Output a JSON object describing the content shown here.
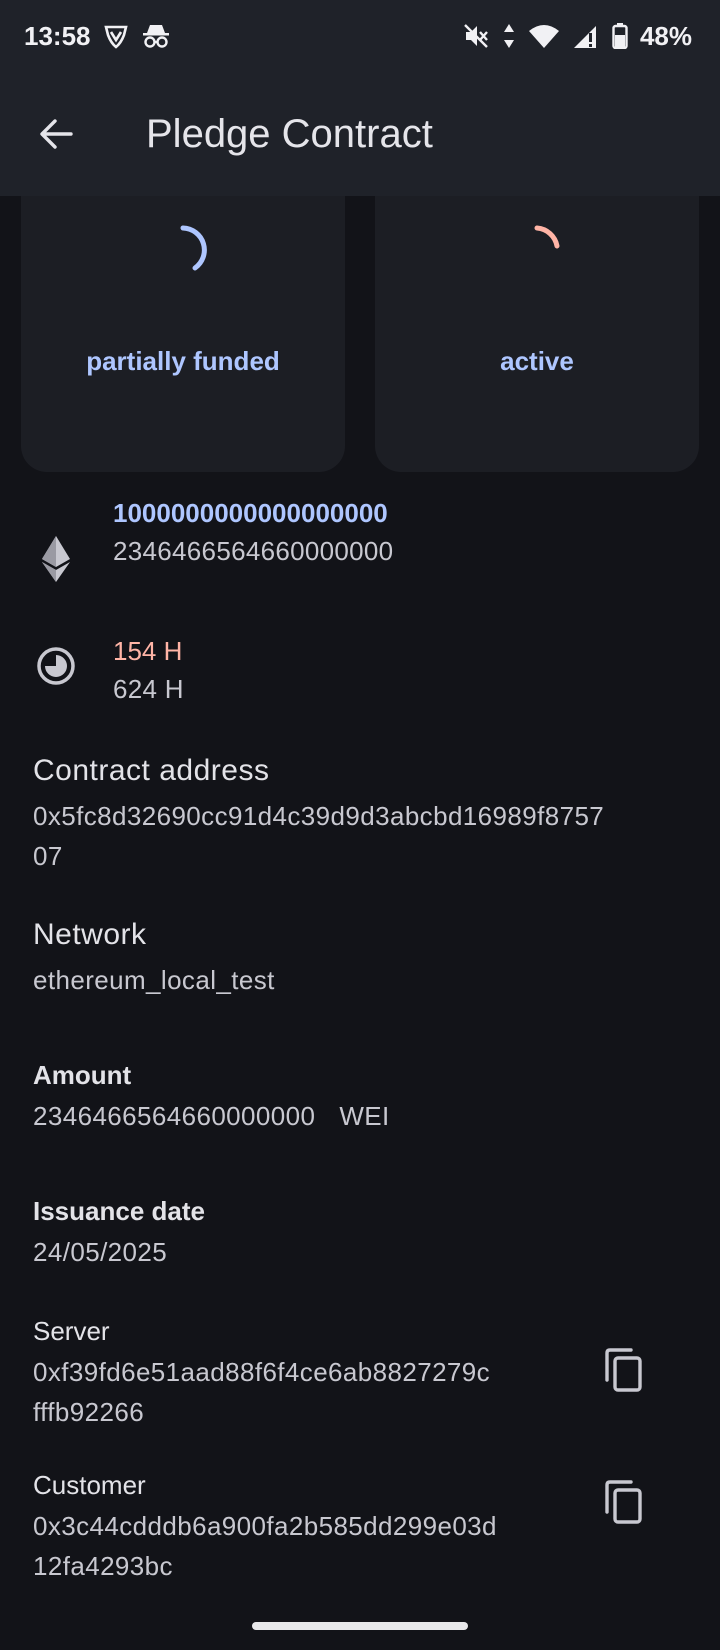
{
  "status_bar": {
    "time": "13:58",
    "battery": "48%",
    "icons": [
      "vpn-shield-icon",
      "incognito-icon",
      "mute-icon",
      "data-arrows-icon",
      "wifi-icon",
      "signal-icon",
      "battery-icon"
    ]
  },
  "app_bar": {
    "title": "Pledge Contract",
    "back_icon": "arrow-left-icon"
  },
  "cards": [
    {
      "label": "partially funded",
      "spinner_color": "#aec6ff",
      "icon": "loading-spinner-icon"
    },
    {
      "label": "active",
      "spinner_color": "#ffb4a6",
      "icon": "loading-spinner-icon"
    }
  ],
  "funding": {
    "icon": "ethereum-icon",
    "target": "1000000000000000000",
    "current": "2346466564660000000",
    "target_color": "#aec6ff"
  },
  "time_info": {
    "icon": "clock-pie-icon",
    "remaining": "154 H",
    "total": "624 H",
    "remaining_color": "#ffb4a6"
  },
  "contract_address": {
    "title": "Contract address",
    "line1": "0x5fc8d32690cc91d4c39d9d3abcbd16989f8757",
    "line2": "07"
  },
  "network": {
    "title": "Network",
    "value": "ethereum_local_test"
  },
  "amount": {
    "title": "Amount",
    "value": "2346466564660000000",
    "unit": "WEI"
  },
  "issuance": {
    "title": "Issuance date",
    "value": "24/05/2025"
  },
  "server": {
    "title": "Server",
    "line1": "0xf39fd6e51aad88f6f4ce6ab8827279c",
    "line2": "fffb92266",
    "copy_icon": "copy-icon"
  },
  "customer": {
    "title": "Customer",
    "line1": "0x3c44cdddb6a900fa2b585dd299e03d",
    "line2": "12fa4293bc",
    "copy_icon": "copy-icon"
  }
}
